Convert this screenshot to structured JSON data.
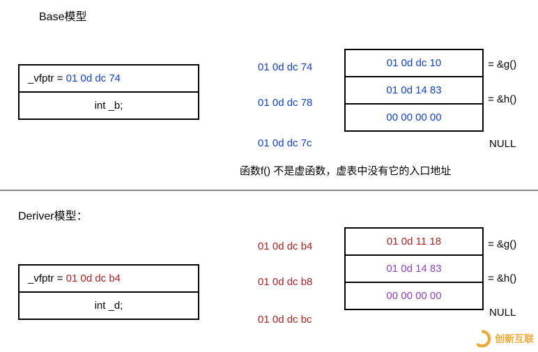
{
  "base": {
    "title": "Base模型",
    "obj": {
      "vfptr_label": "_vfptr =",
      "vfptr_value": "01 0d dc 74",
      "member": "int _b;"
    },
    "addrs": [
      "01 0d dc 74",
      "01 0d dc 78",
      "01 0d dc 7c"
    ],
    "vtable": [
      {
        "val": "01 0d dc 10",
        "eq": "= &g()"
      },
      {
        "val": "01 0d 14 83",
        "eq": "= &h()"
      },
      {
        "val": "00 00 00 00",
        "eq": "NULL"
      }
    ],
    "note": "函数f() 不是虚函数，虚表中没有它的入口地址"
  },
  "deriver": {
    "title": "Deriver模型：",
    "obj": {
      "vfptr_label": "_vfptr =",
      "vfptr_value": "01 0d dc b4",
      "member": "int _d;"
    },
    "addrs": [
      "01 0d dc b4",
      "01 0d dc b8",
      "01 0d dc bc"
    ],
    "vtable": [
      {
        "val": "01 0d 11 18",
        "eq": "= &g()"
      },
      {
        "val": "01 0d 14 83",
        "eq": "= &h()"
      },
      {
        "val": "00 00 00 00",
        "eq": "NULL"
      }
    ]
  },
  "watermark": "创新互联"
}
